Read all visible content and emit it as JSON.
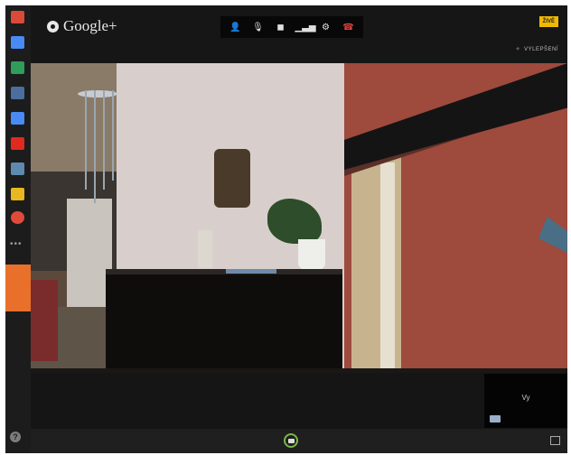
{
  "app": {
    "logo_text": "Google+"
  },
  "sidebar": {
    "apps": [
      {
        "icon": "hangout-effects-icon",
        "color": "#d94a38"
      },
      {
        "icon": "chat-icon",
        "color": "#4a8af4"
      },
      {
        "icon": "screenshare-icon",
        "color": "#2e9e5a"
      },
      {
        "icon": "capture-icon",
        "color": "#4a6e9e"
      },
      {
        "icon": "video-icon",
        "color": "#4a8af4"
      },
      {
        "icon": "youtube-icon",
        "color": "#e02a1e"
      },
      {
        "icon": "scene-icon",
        "color": "#5e8ab0"
      },
      {
        "icon": "sketch-icon",
        "color": "#e8b820"
      },
      {
        "icon": "lifebuoy-icon",
        "color": "#e04a3a"
      }
    ],
    "more_label": "•••",
    "help_label": "?"
  },
  "toolbar": {
    "controls": [
      {
        "icon": "invite-icon",
        "glyph": "👤"
      },
      {
        "icon": "mute-mic-icon",
        "glyph": "🎙"
      },
      {
        "icon": "camera-off-icon",
        "glyph": "◼"
      },
      {
        "icon": "bandwidth-icon",
        "glyph": "▁▃▅"
      },
      {
        "icon": "settings-icon",
        "glyph": "⚙"
      },
      {
        "icon": "hang-up-icon",
        "glyph": "☎"
      }
    ],
    "live_badge": "ŽIVĚ",
    "effects_label": "VYLEPŠENÍ"
  },
  "self_view": {
    "label": "Vy"
  },
  "colors": {
    "accent_orange": "#e8702a",
    "live_yellow": "#f1b800",
    "hangup_red": "#e0403a",
    "snapshot_green": "#7ab648"
  }
}
